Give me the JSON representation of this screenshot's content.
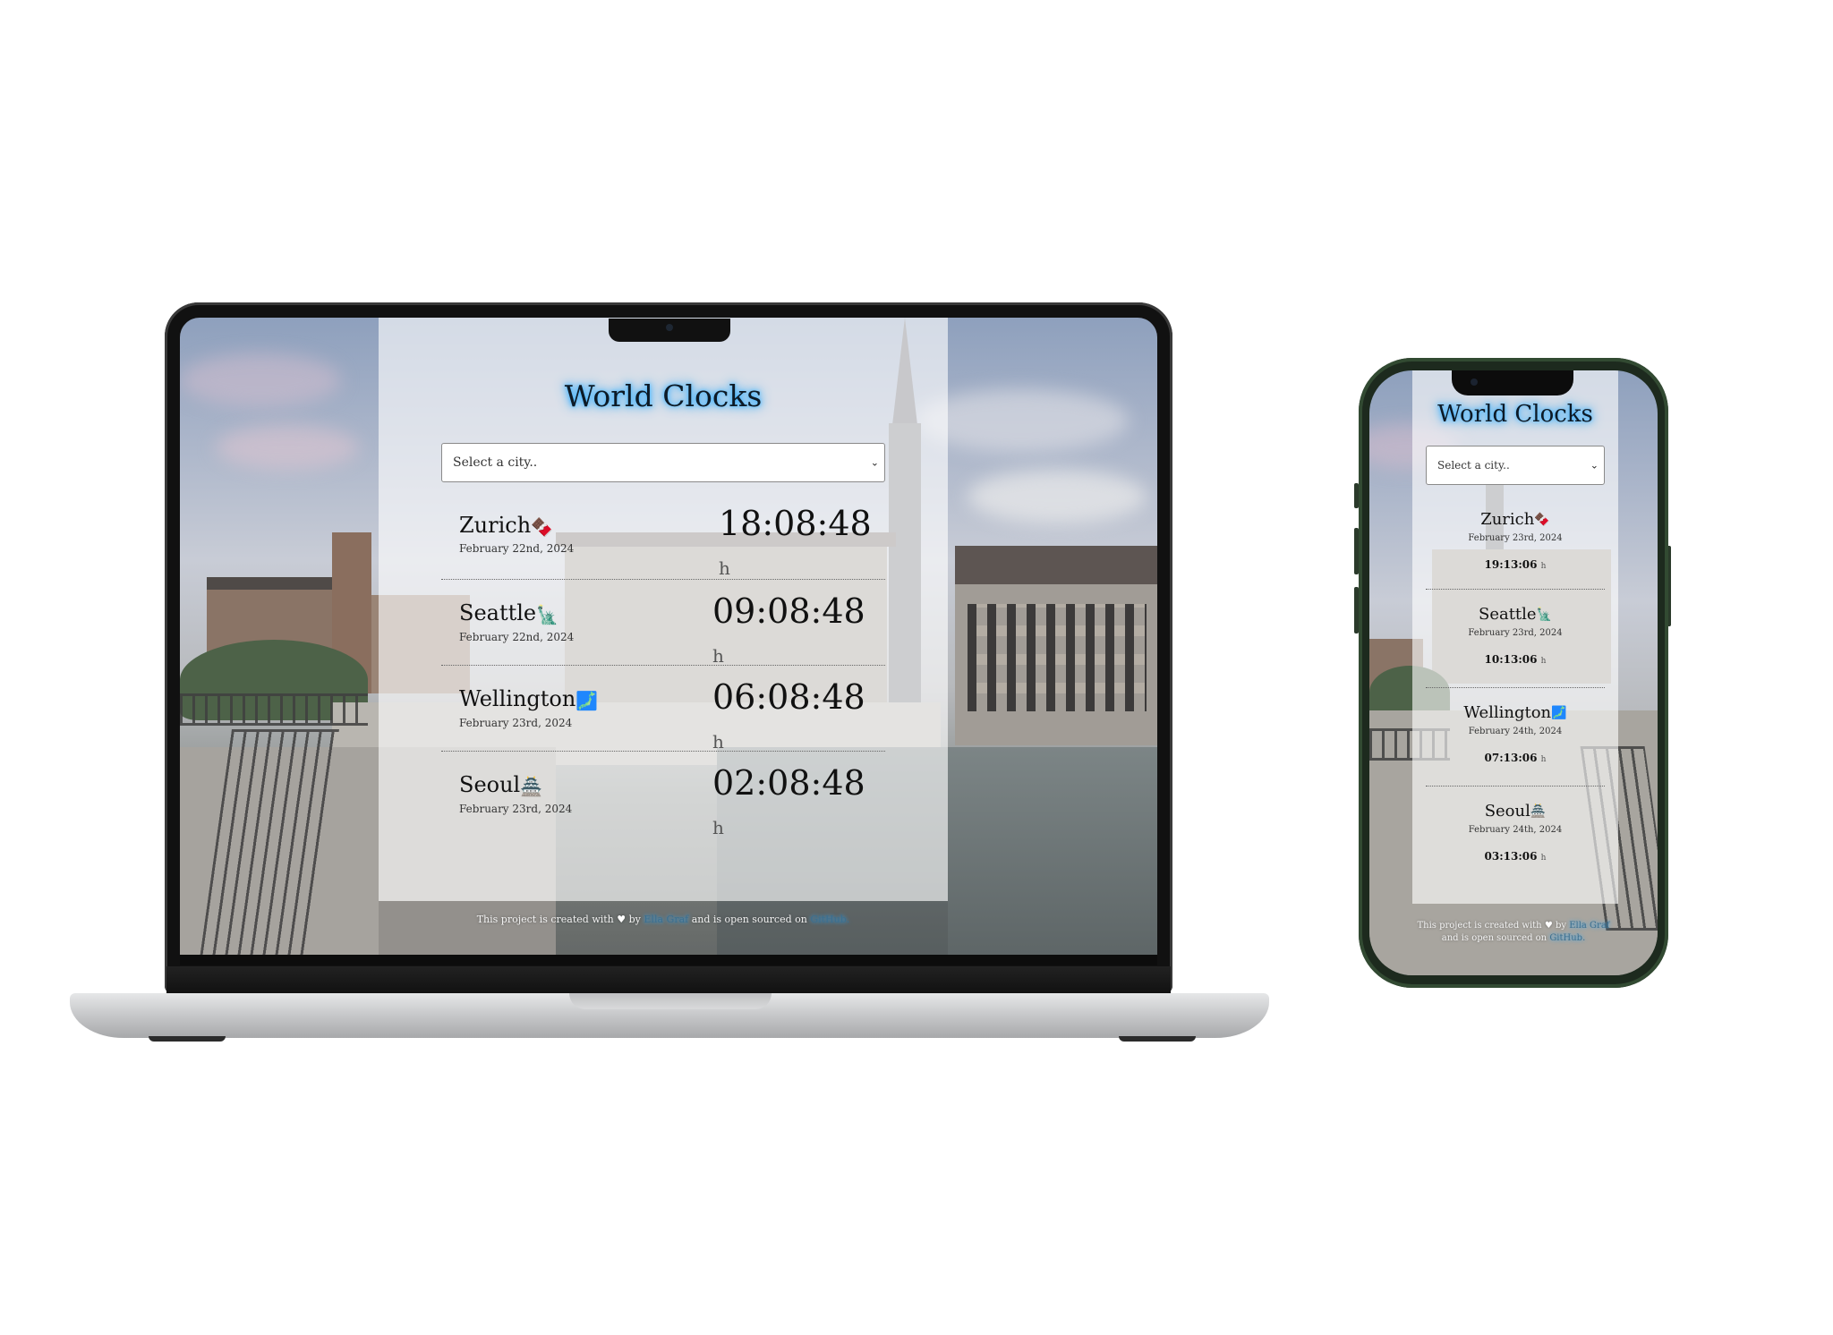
{
  "app": {
    "title": "World Clocks",
    "select_placeholder": "Select a city..",
    "chevron": "⌄",
    "time_unit": "h",
    "footer": {
      "prefix": "This project is created with",
      "heart": "♥",
      "by": "by",
      "author": "Ella Graf",
      "middle": "and is open sourced on",
      "repo": "GitHub."
    }
  },
  "laptop": {
    "cities": [
      {
        "name": "Zurich",
        "emoji": "🍫",
        "date": "February 22nd, 2024",
        "time": "18:08:48"
      },
      {
        "name": "Seattle",
        "emoji": "🗽",
        "date": "February 22nd, 2024",
        "time": "09:08:48"
      },
      {
        "name": "Wellington",
        "emoji": "🗾",
        "date": "February 23rd, 2024",
        "time": "06:08:48"
      },
      {
        "name": "Seoul",
        "emoji": "🏯",
        "date": "February 23rd, 2024",
        "time": "02:08:48"
      }
    ]
  },
  "phone": {
    "cities": [
      {
        "name": "Zurich",
        "emoji": "🍫",
        "date": "February 23rd, 2024",
        "time": "19:13:06"
      },
      {
        "name": "Seattle",
        "emoji": "🗽",
        "date": "February 23rd, 2024",
        "time": "10:13:06"
      },
      {
        "name": "Wellington",
        "emoji": "🗾",
        "date": "February 24th, 2024",
        "time": "07:13:06"
      },
      {
        "name": "Seoul",
        "emoji": "🏯",
        "date": "February 24th, 2024",
        "time": "03:13:06"
      }
    ],
    "footer_line2": "and is open sourced on"
  }
}
